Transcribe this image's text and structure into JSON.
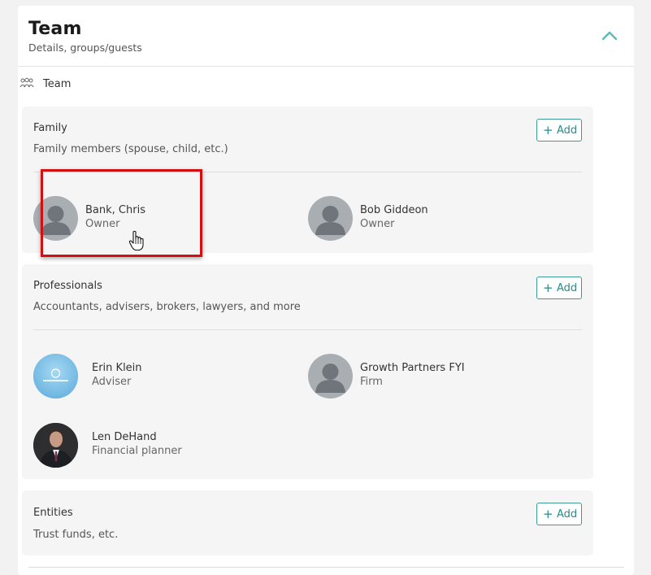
{
  "header": {
    "title": "Team",
    "subtitle": "Details, groups/guests",
    "collapse_icon": "chevron-up-icon"
  },
  "section": {
    "label": "Team",
    "icon": "team-icon"
  },
  "groups": {
    "family": {
      "title": "Family",
      "description": "Family members (spouse, child, etc.)",
      "add_label": "Add",
      "members": [
        {
          "name": "Bank, Chris",
          "role": "Owner",
          "avatar": "default-avatar-icon"
        },
        {
          "name": "Bob Giddeon",
          "role": "Owner",
          "avatar": "default-avatar-icon"
        }
      ]
    },
    "professionals": {
      "title": "Professionals",
      "description": "Accountants, advisers, brokers, lawyers, and more",
      "add_label": "Add",
      "members": [
        {
          "name": "Erin Klein",
          "role": "Adviser",
          "avatar": "logo-avatar"
        },
        {
          "name": "Growth Partners FYI",
          "role": "Firm",
          "avatar": "default-avatar-icon"
        },
        {
          "name": "Len DeHand",
          "role": "Financial planner",
          "avatar": "photo-avatar"
        }
      ]
    },
    "entities": {
      "title": "Entities",
      "description": "Trust funds, etc.",
      "add_label": "Add"
    }
  },
  "colors": {
    "accent": "#2b8a8a",
    "highlight": "#d40f0f",
    "group_bg": "#f5f5f5"
  }
}
